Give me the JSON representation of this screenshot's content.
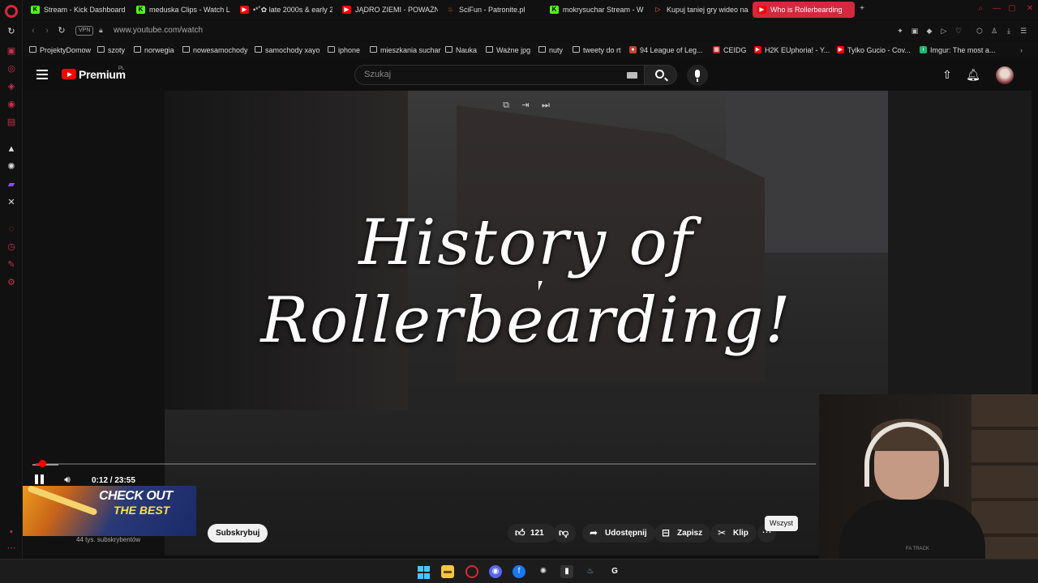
{
  "browser": {
    "tabs": [
      {
        "label": "Stream - Kick Dashboard",
        "icon": "kick-icon",
        "active": false
      },
      {
        "label": "meduska Clips - Watch L",
        "icon": "kick-icon",
        "active": false
      },
      {
        "label": "•*˚✿ late 2000s & early 2",
        "icon": "youtube-icon",
        "active": false
      },
      {
        "label": "JĄDRO ZIEMI - POWAŻN",
        "icon": "youtube-icon",
        "active": false
      },
      {
        "label": "SciFun - Patronite.pl",
        "icon": "flame-icon",
        "active": false
      },
      {
        "label": "mokrysuchar Stream - W",
        "icon": "kick-icon",
        "active": false
      },
      {
        "label": "Kupuj taniej gry wideo na",
        "icon": "store-icon",
        "active": false
      },
      {
        "label": "Who is Rollerbearding",
        "icon": "youtube-icon",
        "active": true
      }
    ],
    "address": {
      "vpn": "VPN",
      "url": "www.youtube.com/watch"
    },
    "bookmarks": [
      "ProjektyDomow",
      "szoty",
      "norwegia",
      "nowesamochody",
      "samochody xayo",
      "iphone",
      "mieszkania suchar",
      "Nauka",
      "Ważne jpg",
      "nuty",
      "tweety do rt",
      "94 League of Leg...",
      "CEIDG",
      "H2K EUphoria! - Y...",
      "Tylko Gucio - Cov...",
      "Imgur: The most a..."
    ]
  },
  "youtube": {
    "brand": "Premium",
    "region": "PL",
    "search_placeholder": "Szukaj",
    "player": {
      "overlay_title_line1": "History of",
      "overlay_title_line2": "Rollerbearding!",
      "time": "0:12 / 23:55",
      "progress_fraction": 0.0084
    },
    "promo": {
      "line1": "CHECK OUT",
      "line2": "THE BEST"
    },
    "channel": {
      "subscribers": "44 tys. subskrybentów",
      "subscribe_label": "Subskrybuj"
    },
    "actions": {
      "likes": "121",
      "share": "Udostępnij",
      "save": "Zapisz",
      "clip": "Klip"
    },
    "chip": "Wszyst"
  },
  "webcam": {
    "shirt_text": "FA TRACK"
  },
  "colors": {
    "accent": "#d3283e",
    "yt_red": "#ff0000",
    "bg": "#0f0f0f"
  }
}
